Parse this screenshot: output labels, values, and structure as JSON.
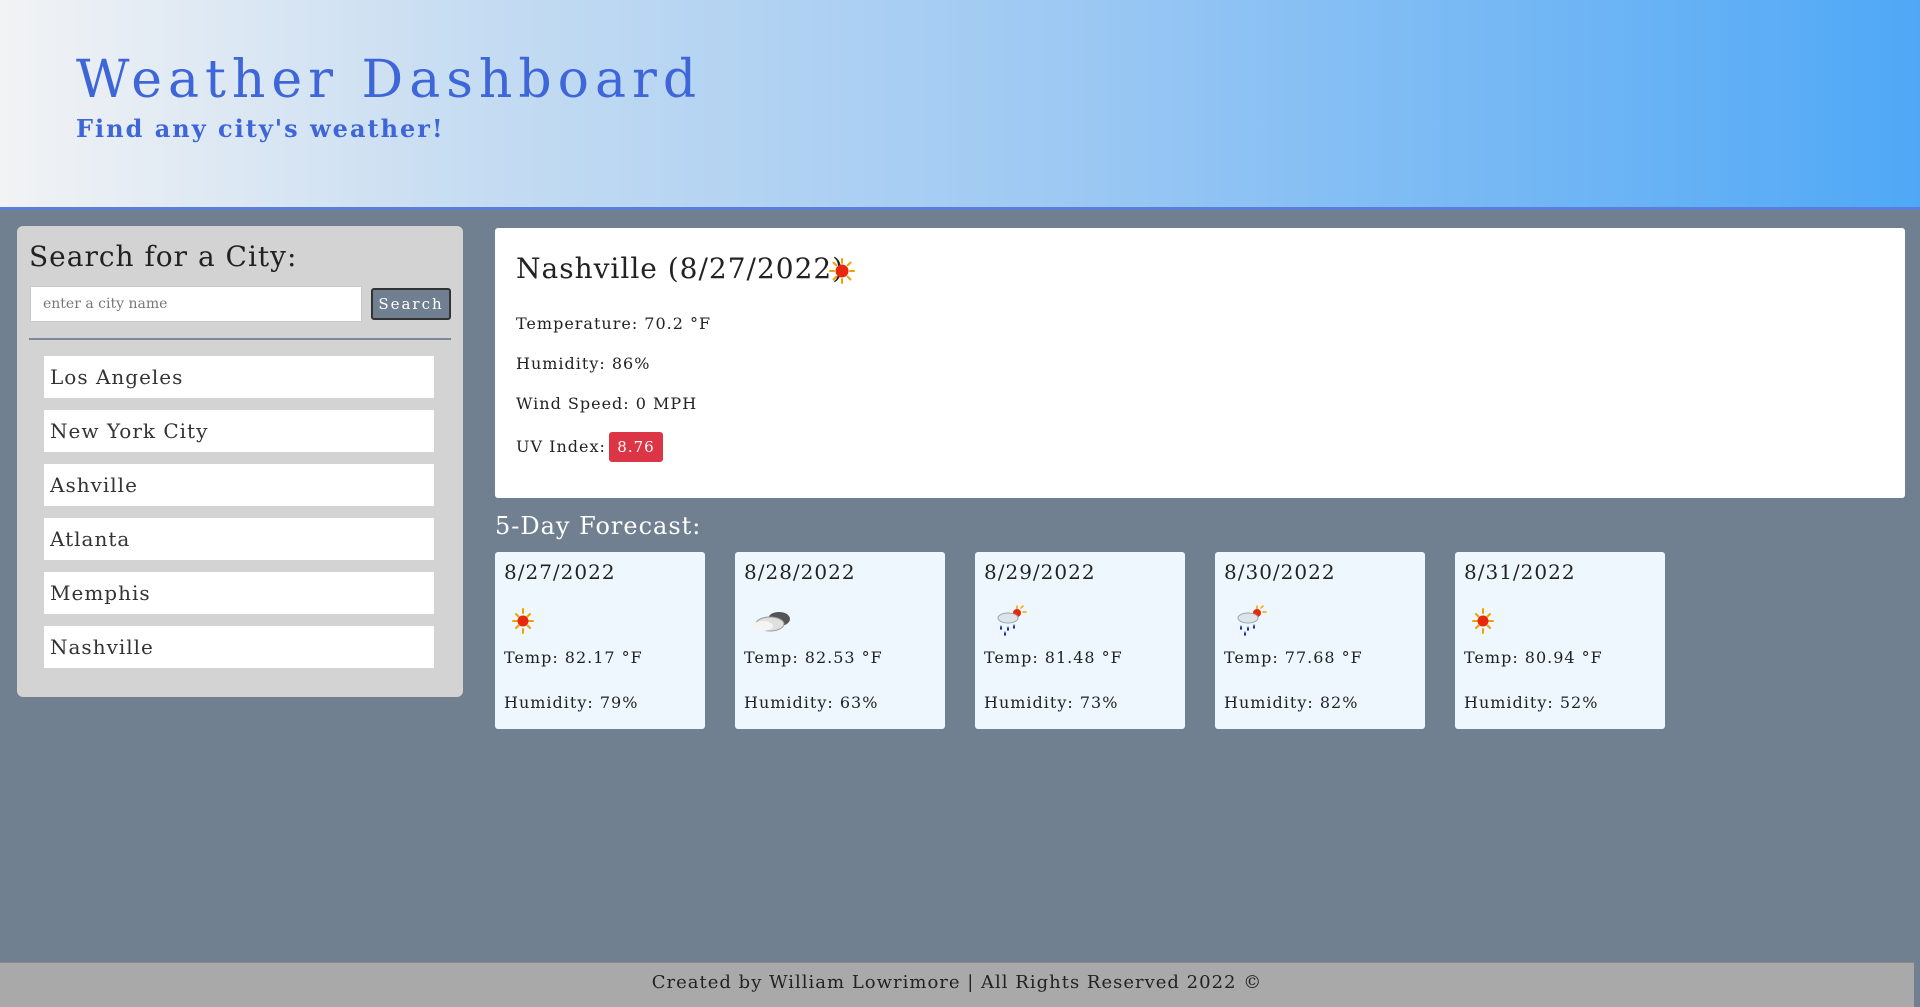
{
  "header": {
    "title": "Weather Dashboard",
    "subtitle": "Find any city's weather!"
  },
  "search": {
    "heading": "Search for a City:",
    "placeholder": "enter a city name",
    "button_label": "Search"
  },
  "history": {
    "cities": [
      "Los Angeles",
      "New York City",
      "Ashville",
      "Atlanta",
      "Memphis",
      "Nashville"
    ]
  },
  "current": {
    "title": "Nashville (8/27/2022)",
    "icon": "sun-icon",
    "temperature": "Temperature: 70.2 °F",
    "humidity": "Humidity: 86%",
    "wind": "Wind Speed: 0 MPH",
    "uv_label": "UV Index:",
    "uv_value": "8.76",
    "uv_color": "#dc3545"
  },
  "forecast": {
    "heading": "5-Day Forecast:",
    "days": [
      {
        "date": "8/27/2022",
        "icon": "sun-icon",
        "temp": "Temp: 82.17 °F",
        "humidity": "Humidity: 79%"
      },
      {
        "date": "8/28/2022",
        "icon": "cloud-icon",
        "temp": "Temp: 82.53 °F",
        "humidity": "Humidity: 63%"
      },
      {
        "date": "8/29/2022",
        "icon": "rain-sun-icon",
        "temp": "Temp: 81.48 °F",
        "humidity": "Humidity: 73%"
      },
      {
        "date": "8/30/2022",
        "icon": "rain-sun-icon",
        "temp": "Temp: 77.68 °F",
        "humidity": "Humidity: 82%"
      },
      {
        "date": "8/31/2022",
        "icon": "sun-icon",
        "temp": "Temp: 80.94 °F",
        "humidity": "Humidity: 52%"
      }
    ]
  },
  "footer": {
    "text": "Created by William Lowrimore | All Rights Reserved 2022 ©"
  }
}
